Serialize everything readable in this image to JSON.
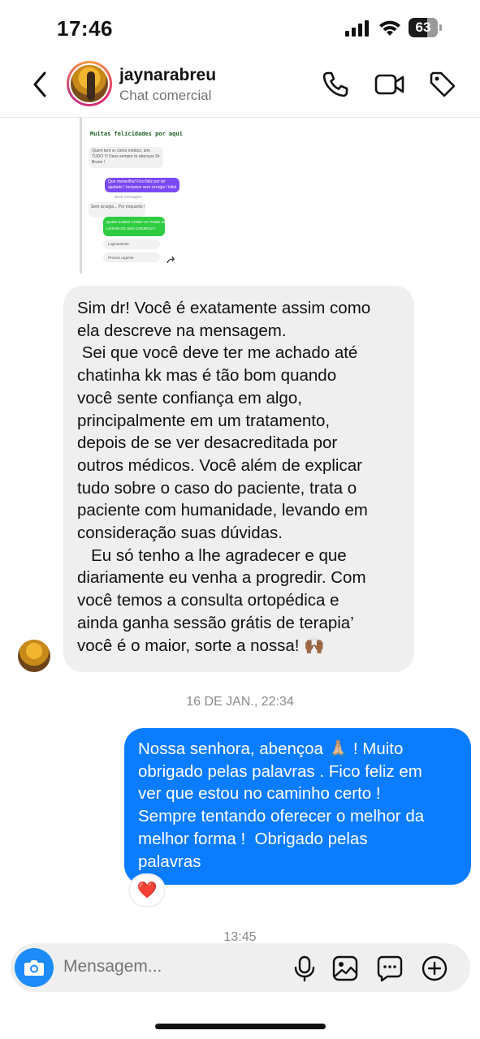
{
  "status_bar": {
    "time": "17:46",
    "battery_level": "63",
    "icons": [
      "cellular-signal-icon",
      "wifi-icon",
      "battery-icon"
    ]
  },
  "header": {
    "username": "jaynarabreu",
    "subtitle": "Chat comercial",
    "icons": [
      "back-chevron-icon",
      "phone-icon",
      "video-camera-icon",
      "tag-icon"
    ]
  },
  "shared_preview": {
    "caption": "Muitas felicidades por aqui",
    "lines": [
      "Quem tem vc como médico, tem",
      "TUDO !!! Deus sempre te abençoe Dr.",
      "Bruno !",
      "Que maravilha! Fico feliz por ter",
      "ajudado ! Inclusive sem cirurgia ! kkkk",
      "Nova mensagem",
      "Sem cirurgia... Por enquanto !",
      "QUER SABER COMO VC PODE SE",
      "LIVRAR DE UMA CIRURGIA?",
      "Logicamente",
      "Preciso urgente"
    ]
  },
  "messages": {
    "received_text": "Sim dr! Você é exatamente assim como\nela descreve na mensagem.\n Sei que você deve ter me achado até\nchatinha kk mas é tão bom quando\nvocê sente confiança em algo,\nprincipalmente em um tratamento,\ndepois de se ver desacreditada por\noutros médicos. Você além de explicar\ntudo sobre o caso do paciente, trata o\npaciente com humanidade, levando em\nconsideração suas dúvidas.\n   Eu só tenho a lhe agradecer e que\ndiariamente eu venha a progredir. Com\nvocê temos a consulta ortopédica e\nainda ganha sessão grátis de terapia’\nvocê é o maior, sorte a nossa! 🙌🏾",
    "timestamp_1": "16 DE JAN., 22:34",
    "sent_text": "Nossa senhora, abençoa 🙏🏼 ! Muito\nobrigado pelas palavras . Fico feliz em\nver que estou no caminho certo !\nSempre tentando oferecer o melhor da\nmelhor forma !  Obrigado pelas\npalavras",
    "sent_reaction": "❤️",
    "timestamp_2": "13:45"
  },
  "composer": {
    "placeholder": "Mensagem...",
    "icons": [
      "camera-icon",
      "microphone-icon",
      "image-gallery-icon",
      "sticker-chat-icon",
      "plus-circle-icon"
    ]
  },
  "colors": {
    "sent_bubble": "#0a7cff",
    "received_bubble": "#efefef",
    "camera_button": "#1d8cf8",
    "secondary_text": "#737373"
  }
}
